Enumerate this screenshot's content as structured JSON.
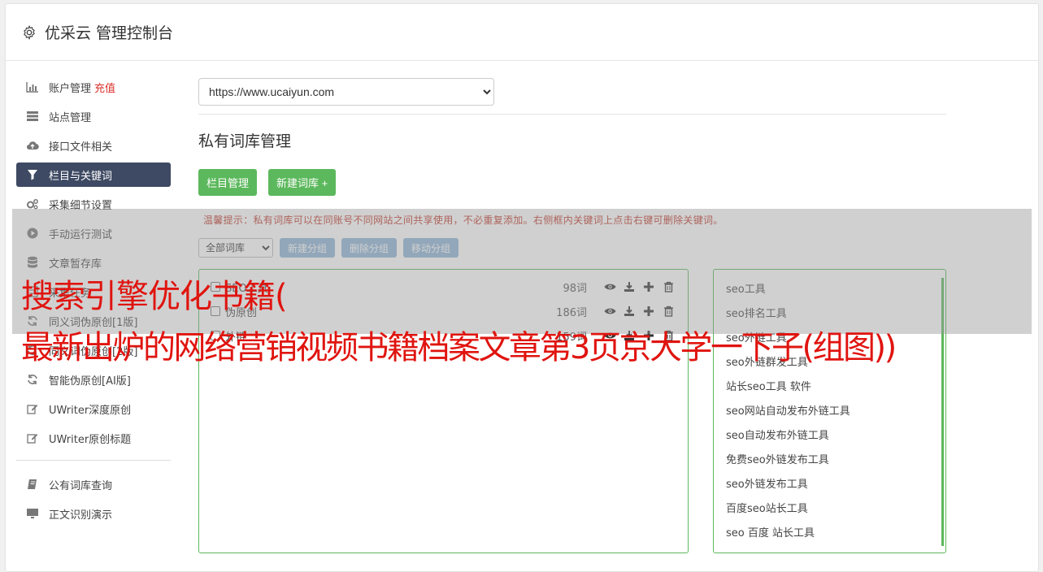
{
  "header": {
    "title": "优采云 管理控制台",
    "icon": "gear-icon"
  },
  "sidebar": {
    "items": [
      {
        "label": "账户管理",
        "badge": "充值",
        "icon": "bar-chart-icon"
      },
      {
        "label": "站点管理",
        "icon": "server-icon"
      },
      {
        "label": "接口文件相关",
        "icon": "cloud-upload-icon"
      },
      {
        "label": "栏目与关键词",
        "icon": "filter-icon",
        "active": true
      },
      {
        "label": "采集细节设置",
        "icon": "cogs-icon"
      },
      {
        "label": "手动运行测试",
        "icon": "play-icon"
      },
      {
        "label": "文章暂存库",
        "icon": "database-icon"
      },
      {
        "label": "采集任务",
        "icon": "tasks-icon"
      },
      {
        "label": "同义词伪原创[1版]",
        "icon": "refresh-icon"
      },
      {
        "label": "同义词伪原创[2版]",
        "icon": "refresh-icon"
      },
      {
        "label": "智能伪原创[AI版]",
        "icon": "refresh-icon"
      },
      {
        "label": "UWriter深度原创",
        "icon": "edit-icon"
      },
      {
        "label": "UWriter原创标题",
        "icon": "edit-icon"
      }
    ],
    "items2": [
      {
        "label": "公有词库查询",
        "icon": "book-icon"
      },
      {
        "label": "正文识别演示",
        "icon": "monitor-icon"
      }
    ]
  },
  "main": {
    "site_select": "https://www.ucaiyun.com",
    "section_title": "私有词库管理",
    "btn_column": "栏目管理",
    "btn_new_lib": "新建词库 +",
    "tip": "温馨提示：私有词库可以在同账号不同网站之间共享使用，不必重复添加。右侧框内关键词上点击右键可删除关键词。",
    "filter_select": "全部词库",
    "btn_new_group": "新建分组",
    "btn_del_group": "删除分组",
    "btn_move_group": "移动分组",
    "libraries": [
      {
        "name": "SEO工具",
        "count": "98词"
      },
      {
        "name": "伪原创",
        "count": "186词"
      },
      {
        "name": "外链",
        "count": "159词"
      }
    ],
    "keywords": [
      "seo工具",
      "seo排名工具",
      "seo外链工具",
      "seo外链群发工具",
      "站长seo工具 软件",
      "seo网站自动发布外链工具",
      "seo自动发布外链工具",
      "免费seo外链发布工具",
      "seo外链发布工具",
      "百度seo站长工具",
      "seo 百度 站长工具"
    ]
  },
  "overlay": {
    "line1": "搜索引擎优化书籍(",
    "line2": "最新出炉的网络营销视频书籍档案文章第3页京大学一下子(组图))"
  }
}
